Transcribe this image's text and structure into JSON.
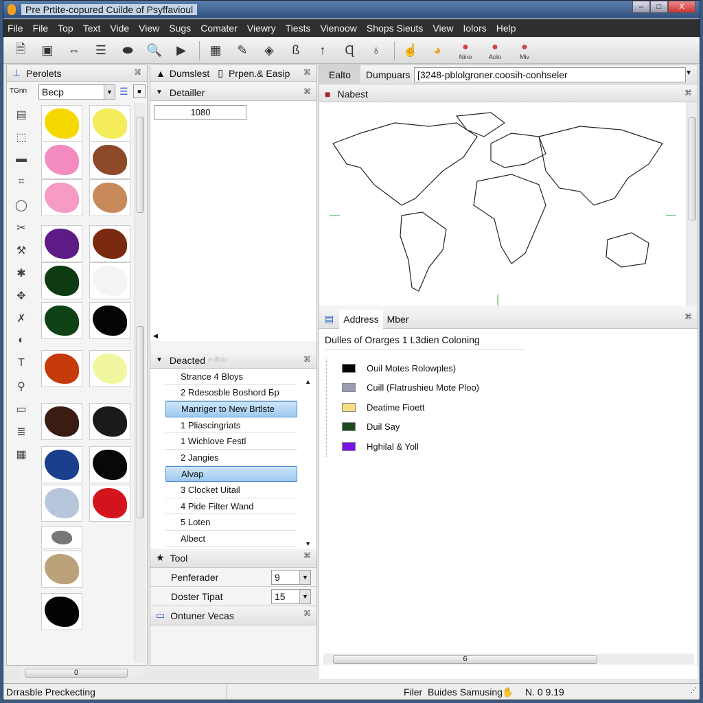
{
  "window": {
    "title": "Pre Prtite-copured Cuilde of Psyffavioul",
    "buttons": [
      "minimize",
      "maximize",
      "close"
    ]
  },
  "menu": [
    "File",
    "File",
    "Top",
    "Text",
    "Vide",
    "View",
    "Sugs",
    "Comater",
    "Viewry",
    "Tiests",
    "Vienoow",
    "Shops Sieuts",
    "View",
    "Iolors",
    "Help"
  ],
  "toolbar": {
    "icons": [
      "new-document-icon",
      "save-icon",
      "swap-arrows-icon",
      "list-icon",
      "stamp-icon",
      "zoom-icon",
      "play-icon",
      "calculator-icon",
      "pencil-icon",
      "ruler-icon",
      "curve-icon",
      "arrow-up-icon",
      "lasso-icon",
      "bell-icon",
      "hand-icon",
      "globe-icon"
    ],
    "labeled": [
      {
        "icon": "badge-icon",
        "label": "Nino"
      },
      {
        "icon": "badge-icon",
        "label": "Aolo"
      },
      {
        "icon": "badge-icon",
        "label": "Miv"
      }
    ]
  },
  "left_panel": {
    "title": "Perolets",
    "combo_label": "TGnn",
    "combo_value": "Becp",
    "scroll_value": "0",
    "tool_icons": [
      "rectangle-select-icon",
      "fill-icon",
      "eraser-icon",
      "crop-icon",
      "circle-icon",
      "brush-icon",
      "hammer-icon",
      "spray-icon",
      "wand-icon",
      "knife-icon",
      "gradient-icon",
      "text-icon",
      "zoom-icon",
      "folder-icon",
      "layers-icon",
      "grid-icon"
    ],
    "swatches": [
      "#f5d800",
      "#f4ec5a",
      "#f48bc0",
      "#8e4a28",
      "#f59bc4",
      "#c88a5a",
      "#5e1b86",
      "#7a2a10",
      "#0f3b12",
      "#f4f4f4",
      "#0f4214",
      "#050505",
      "#c43a08",
      "#f1f7a0",
      "#3a1c12",
      "#1a1a1a",
      "#1a3f8c",
      "#080808",
      "#b8c6dc",
      "#d4141c",
      "#777777",
      "#bca27a",
      "#030303"
    ]
  },
  "middle_panel": {
    "tabs": [
      "Dumslest",
      "Prpen.& Easip"
    ],
    "details_title": "Detailler",
    "value": "1080",
    "list_title": "Deacted",
    "list_subtitle": "e-ifldo",
    "items": [
      {
        "label": "Strance 4 Bloys",
        "selected": false
      },
      {
        "label": "2  Rdesosble Boshord Бр",
        "selected": false
      },
      {
        "label": "Manriger to New Brtlste",
        "selected": true
      },
      {
        "label": "1  Pliascingriats",
        "selected": false
      },
      {
        "label": "1  Wichlove Festl",
        "selected": false
      },
      {
        "label": "2  Jangies",
        "selected": false
      },
      {
        "label": "Alvap",
        "selected": true
      },
      {
        "label": "3  Clocket Uitail",
        "selected": false
      },
      {
        "label": "4  Pide Filter Wand",
        "selected": false
      },
      {
        "label": "5  Loten",
        "selected": false
      },
      {
        "label": "Albect",
        "selected": false
      }
    ],
    "tool_title": "Tool",
    "fields": [
      {
        "label": "Penferader",
        "value": "9"
      },
      {
        "label": "Doster Tipat",
        "value": "15"
      }
    ],
    "bottom_title": "Ontuner Vecas"
  },
  "right_panel": {
    "tabs": [
      "Ealto",
      "Dumpuars"
    ],
    "address": "[3248-pblolgroner.coosih-conhseler",
    "map_title": "Nabest",
    "bottom_tabs": [
      "Address",
      "Mber"
    ],
    "legend_title": "Dulles of Orarges 1 L3dien Coloning",
    "legend": [
      {
        "label": "Ouil Motes Rolowples)",
        "color": "#050505"
      },
      {
        "label": "Cuill (Flatrushieu Mote Ploo)",
        "color": "#9a9cb4"
      },
      {
        "label": "Deatime Fioett",
        "color": "#f7dc82"
      },
      {
        "label": "Duil Say",
        "color": "#1f4a22"
      },
      {
        "label": "Hghilal & Yoll",
        "color": "#7a10e8"
      }
    ],
    "scroll_value": "6"
  },
  "status": {
    "left": "Drrasble Preckecting",
    "filter": "Filer",
    "mode": "Buides Samusing",
    "coords": "N. 0   9.19"
  }
}
